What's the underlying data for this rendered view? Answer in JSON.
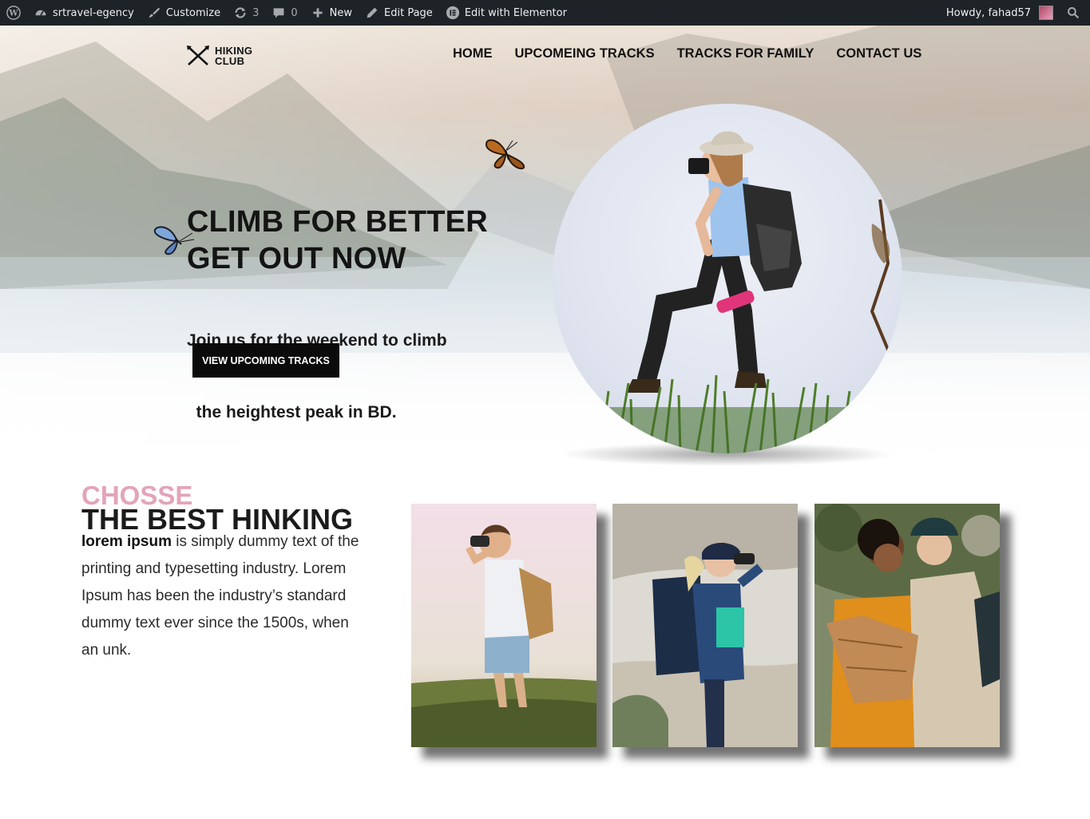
{
  "adminbar": {
    "wp_icon": "wordpress-logo-icon",
    "site_name": "srtravel-egency",
    "customize": "Customize",
    "updates_count": "3",
    "comments_count": "0",
    "new_label": "New",
    "edit_page": "Edit Page",
    "edit_elementor": "Edit with Elementor",
    "howdy": "Howdy, fahad57"
  },
  "logo": {
    "line1": "HIKING",
    "line2": "CLUB"
  },
  "nav": [
    "HOME",
    "UPCOMEING TRACKS",
    "TRACKS FOR FAMILY",
    "CONTACT US"
  ],
  "hero": {
    "headline_1": "CLIMB FOR BETTER",
    "headline_2": "GET OUT NOW",
    "subline_1": "Join us for the weekend to climb",
    "subline_2": "  the heightest peak in BD.",
    "cta": "VIEW UPCOMING TRACKS"
  },
  "section": {
    "title_a": "CHOSSE",
    "title_b": "THE BEST HINKING",
    "body_bold": "lorem ipsum",
    "body_rest": " is simply dummy text of the printing and typesetting industry. Lorem Ipsum has been the industry’s standard dummy text ever since the 1500s, when an unk."
  },
  "colors": {
    "accent_pink": "#e4a4b8",
    "adminbar_bg": "#1d2327",
    "button_bg": "#0b0b0b"
  }
}
